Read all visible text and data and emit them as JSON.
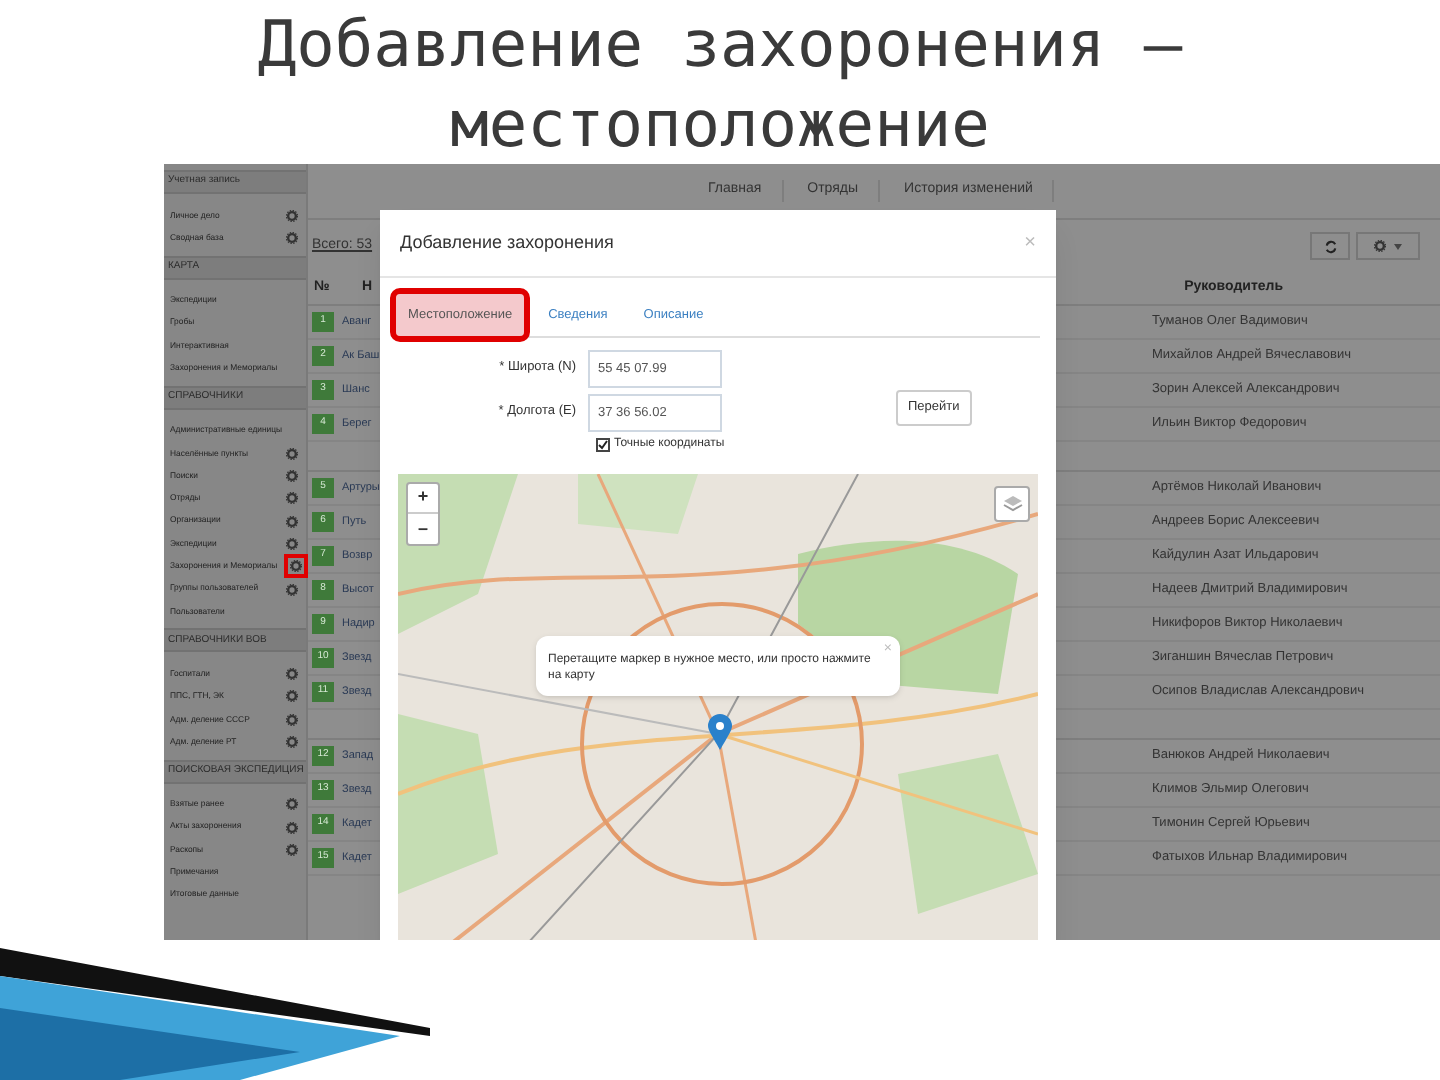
{
  "slide_title": [
    "Добавление захоронения –",
    "местоположение"
  ],
  "sidebar": {
    "sections": [
      {
        "header": "Учетная запись",
        "items": [
          {
            "label": "Личное дело",
            "gear": true,
            "highlighted": false
          },
          {
            "label": "Сводная база",
            "gear": true,
            "highlighted": false
          }
        ]
      },
      {
        "header": "КАРТА",
        "items": [
          {
            "label": "Экспедиции",
            "gear": false
          },
          {
            "label": "Гробы",
            "gear": false
          },
          {
            "label": "Интерактивная",
            "gear": false
          },
          {
            "label": "Захоронения и Мемориалы",
            "gear": false
          }
        ]
      },
      {
        "header": "СПРАВОЧНИКИ",
        "items": [
          {
            "label": "Административные единицы",
            "gear": false
          },
          {
            "label": "Населённые пункты",
            "gear": true,
            "highlighted": false
          },
          {
            "label": "Поиски",
            "gear": true,
            "highlighted": false
          },
          {
            "label": "Отряды",
            "gear": true,
            "highlighted": false
          },
          {
            "label": "Организации",
            "gear": true,
            "highlighted": false
          },
          {
            "label": "Экспедиции",
            "gear": true,
            "highlighted": false
          },
          {
            "label": "Захоронения и Мемориалы",
            "gear": true,
            "highlighted": true
          },
          {
            "label": "Группы пользователей",
            "gear": true,
            "highlighted": false
          },
          {
            "label": "Пользователи",
            "gear": false
          }
        ]
      },
      {
        "header": "СПРАВОЧНИКИ ВОВ",
        "items": [
          {
            "label": "Госпитали",
            "gear": true,
            "highlighted": false
          },
          {
            "label": "ППС, ГТН, ЭК",
            "gear": true,
            "highlighted": false
          },
          {
            "label": "Адм. деление СССР",
            "gear": true,
            "highlighted": false
          },
          {
            "label": "Адм. деление РТ",
            "gear": true,
            "highlighted": false
          }
        ]
      },
      {
        "header": "ПОИСКОВАЯ ЭКСПЕДИЦИЯ",
        "items": [
          {
            "label": "Взятые ранее",
            "gear": true,
            "highlighted": false
          },
          {
            "label": "Акты захоронения",
            "gear": true,
            "highlighted": false
          },
          {
            "label": "Раскопы",
            "gear": true,
            "highlighted": false
          },
          {
            "label": "Примечания",
            "gear": false
          },
          {
            "label": "Итоговые данные",
            "gear": false
          }
        ]
      }
    ]
  },
  "top_nav": [
    "Главная",
    "Отряды",
    "История изменений"
  ],
  "total": "Всего: 53",
  "table": {
    "columns": [
      "№",
      "Н",
      "Руководитель"
    ],
    "row_groups": [
      [
        {
          "n": "1",
          "name": "Аванг",
          "leader": "Туманов Олег Вадимович"
        },
        {
          "n": "2",
          "name": "Ак Баш",
          "leader": "Михайлов Андрей Вячеславович"
        },
        {
          "n": "3",
          "name": "Шанс",
          "leader": "Зорин Алексей Александрович"
        },
        {
          "n": "4",
          "name": "Берег",
          "leader": "Ильин Виктор Федорович"
        }
      ],
      [
        {
          "n": "5",
          "name": "Артуры",
          "leader": "Артёмов Николай Иванович"
        },
        {
          "n": "6",
          "name": "Путь",
          "leader": "Андреев Борис Алексеевич"
        },
        {
          "n": "7",
          "name": "Возвр",
          "leader": "Кайдулин Азат Ильдарович"
        },
        {
          "n": "8",
          "name": "Высот",
          "leader": "Надеев Дмитрий Владимирович"
        },
        {
          "n": "9",
          "name": "Надир",
          "leader": "Никифоров Виктор Николаевич"
        },
        {
          "n": "10",
          "name": "Звезд",
          "leader": "Зиганшин Вячеслав Петрович"
        },
        {
          "n": "11",
          "name": "Звезд",
          "leader": "Осипов Владислав Александрович"
        }
      ],
      [
        {
          "n": "12",
          "name": "Запад",
          "leader": "Ванюков Андрей Николаевич"
        },
        {
          "n": "13",
          "name": "Звезд",
          "leader": "Климов Эльмир Олегович"
        },
        {
          "n": "14",
          "name": "Кадет",
          "leader": "Тимонин Сергей Юрьевич"
        },
        {
          "n": "15",
          "name": "Кадет",
          "leader": "Фатыхов Ильнар Владимирович"
        }
      ]
    ]
  },
  "modal": {
    "title": "Добавление захоронения",
    "close": "×",
    "tabs": [
      {
        "label": "Местоположение",
        "selected": true,
        "highlighted": true
      },
      {
        "label": "Сведения",
        "selected": false,
        "highlighted": false
      },
      {
        "label": "Описание",
        "selected": false,
        "highlighted": false
      }
    ],
    "fields": [
      {
        "label": "* Широта (N)",
        "value": "55 45 07.99"
      },
      {
        "label": "* Долгота (E)",
        "value": "37 36 56.02"
      }
    ],
    "go_button": "Перейти",
    "exact_coords": {
      "label": "Точные координаты",
      "checked": true
    },
    "map": {
      "zoom_in": "+",
      "zoom_out": "–",
      "popup": {
        "text": "Перетащите маркер в нужное место, или просто нажмите на карту",
        "close": "×"
      }
    }
  }
}
